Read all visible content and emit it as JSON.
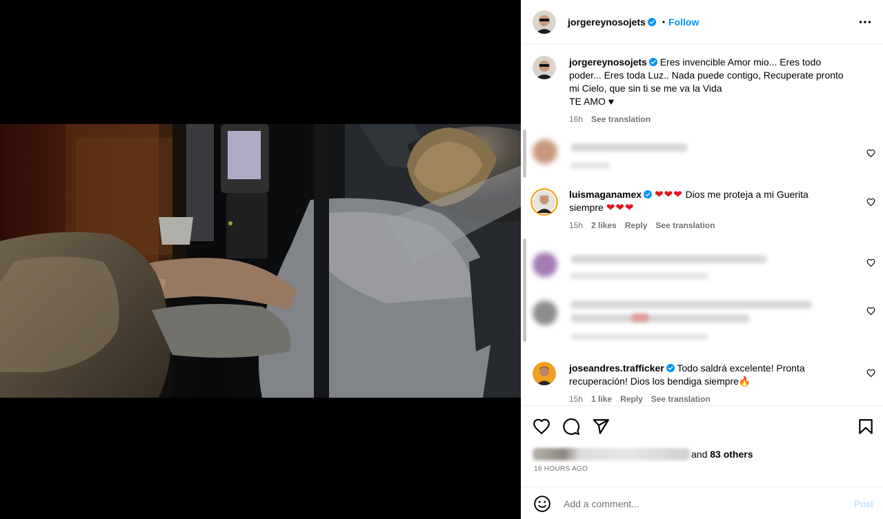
{
  "post": {
    "author": "jorgereynosojets",
    "follow_label": "Follow",
    "separator": "•",
    "caption_lines": [
      "Eres invencible Amor mio... Eres todo",
      "poder... Eres toda Luz.. Nada puede contigo, Recuperate pronto",
      "mi Cielo, que sin ti se me va la Vida",
      "TE AMO ♥"
    ],
    "caption_time": "16h",
    "caption_translation": "See translation"
  },
  "comments": [
    {
      "user": "luismaganamex",
      "text_line1": "Dios me proteja a mi Guerita",
      "text_line2": "siempre",
      "time": "15h",
      "likes": "2 likes",
      "reply": "Reply",
      "translation": "See translation"
    },
    {
      "user": "joseandres.trafficker",
      "text_line1": "Todo saldrá excelente! Pronta",
      "text_line2": "recuperación! Dios los bendiga siempre🔥",
      "time": "15h",
      "likes": "1 like",
      "reply": "Reply",
      "translation": "See translation"
    }
  ],
  "likes_summary": {
    "connector": "and",
    "others": "83 others"
  },
  "time_ago": "16 HOURS AGO",
  "comment_box": {
    "placeholder": "Add a comment...",
    "post_label": "Post"
  },
  "icons": {
    "verified": "verified-badge-icon",
    "more": "more-options-icon",
    "like": "heart-icon",
    "comment": "comment-bubble-icon",
    "share": "paper-plane-icon",
    "save": "bookmark-icon",
    "emoji": "smiley-icon"
  },
  "colors": {
    "accent": "#0095f6",
    "verified": "#0095f6",
    "muted_text": "#737373",
    "post_disabled": "#b3dbff"
  }
}
